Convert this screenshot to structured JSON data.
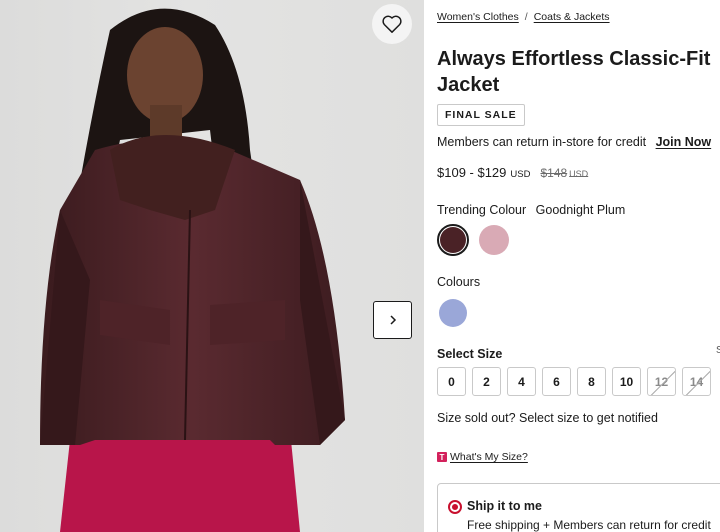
{
  "breadcrumb": [
    "Women's Clothes",
    "Coats & Jackets"
  ],
  "product": {
    "title": "Always Effortless Classic-Fit Jacket",
    "badge": "FINAL SALE"
  },
  "members": {
    "text": "Members can return in-store for credit",
    "join_label": "Join Now"
  },
  "price": {
    "range": "$109 - $129",
    "currency": "USD",
    "was": "$148",
    "was_currency": "USD"
  },
  "trending": {
    "label": "Trending Colour",
    "selected_name": "Goodnight Plum",
    "swatches": [
      {
        "name": "Goodnight Plum",
        "color": "#4a2226",
        "selected": true
      },
      {
        "name": "pink",
        "color": "#d9aab5",
        "selected": false
      }
    ]
  },
  "colours": {
    "label": "Colours",
    "swatches": [
      {
        "name": "periwinkle",
        "color": "#9aa7d8",
        "selected": false
      }
    ]
  },
  "sizes": {
    "label": "Select Size",
    "options": [
      {
        "label": "0",
        "available": true
      },
      {
        "label": "2",
        "available": true
      },
      {
        "label": "4",
        "available": true
      },
      {
        "label": "6",
        "available": true
      },
      {
        "label": "8",
        "available": true
      },
      {
        "label": "10",
        "available": true
      },
      {
        "label": "12",
        "available": false
      },
      {
        "label": "14",
        "available": false
      }
    ],
    "sold_out_text": "Size sold out? Select size to get notified",
    "guide_logo": "T",
    "guide_link": "What's My Size?",
    "edge_text": "S"
  },
  "shipping": {
    "title": "Ship it to me",
    "subtitle": "Free shipping + Members can return for credit"
  },
  "icons": {
    "wishlist": "heart-icon",
    "next": "chevron-right-icon",
    "radio": "radio-selected-icon"
  },
  "colors": {
    "accent_red": "#c8102e",
    "plum": "#4a2226",
    "skirt": "#b8154a"
  }
}
